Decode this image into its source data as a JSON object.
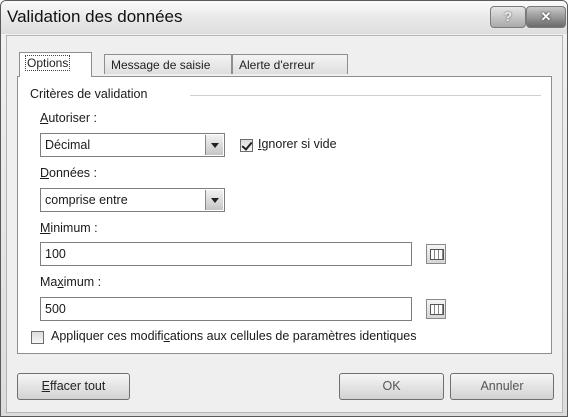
{
  "dialog": {
    "title": "Validation des données",
    "help_glyph": "?",
    "close_glyph": "✕"
  },
  "tabs": [
    {
      "label": "Options",
      "active": true
    },
    {
      "label": "Message de saisie",
      "active": false
    },
    {
      "label": "Alerte d'erreur",
      "active": false
    }
  ],
  "criteria": {
    "group_label": "Critères de validation",
    "allow": {
      "label_u": "A",
      "label_rest": "utoriser :",
      "value": "Décimal"
    },
    "ignore_blank": {
      "label_u": "I",
      "label_rest": "gnorer si vide",
      "checked": true
    },
    "data": {
      "label_u": "D",
      "label_rest": "onnées :",
      "value": "comprise entre"
    },
    "minimum": {
      "label_u": "M",
      "label_rest": "inimum :",
      "value": "100"
    },
    "maximum": {
      "label_pre": "Ma",
      "label_u": "x",
      "label_rest": "imum :",
      "value": "500"
    },
    "apply": {
      "label_pre": "Appliquer ces modifi",
      "label_u": "c",
      "label_rest": "ations aux cellules de paramètres identiques",
      "checked": false
    }
  },
  "buttons": {
    "clear_u": "E",
    "clear_rest": "ffacer tout",
    "ok": "OK",
    "cancel": "Annuler"
  }
}
